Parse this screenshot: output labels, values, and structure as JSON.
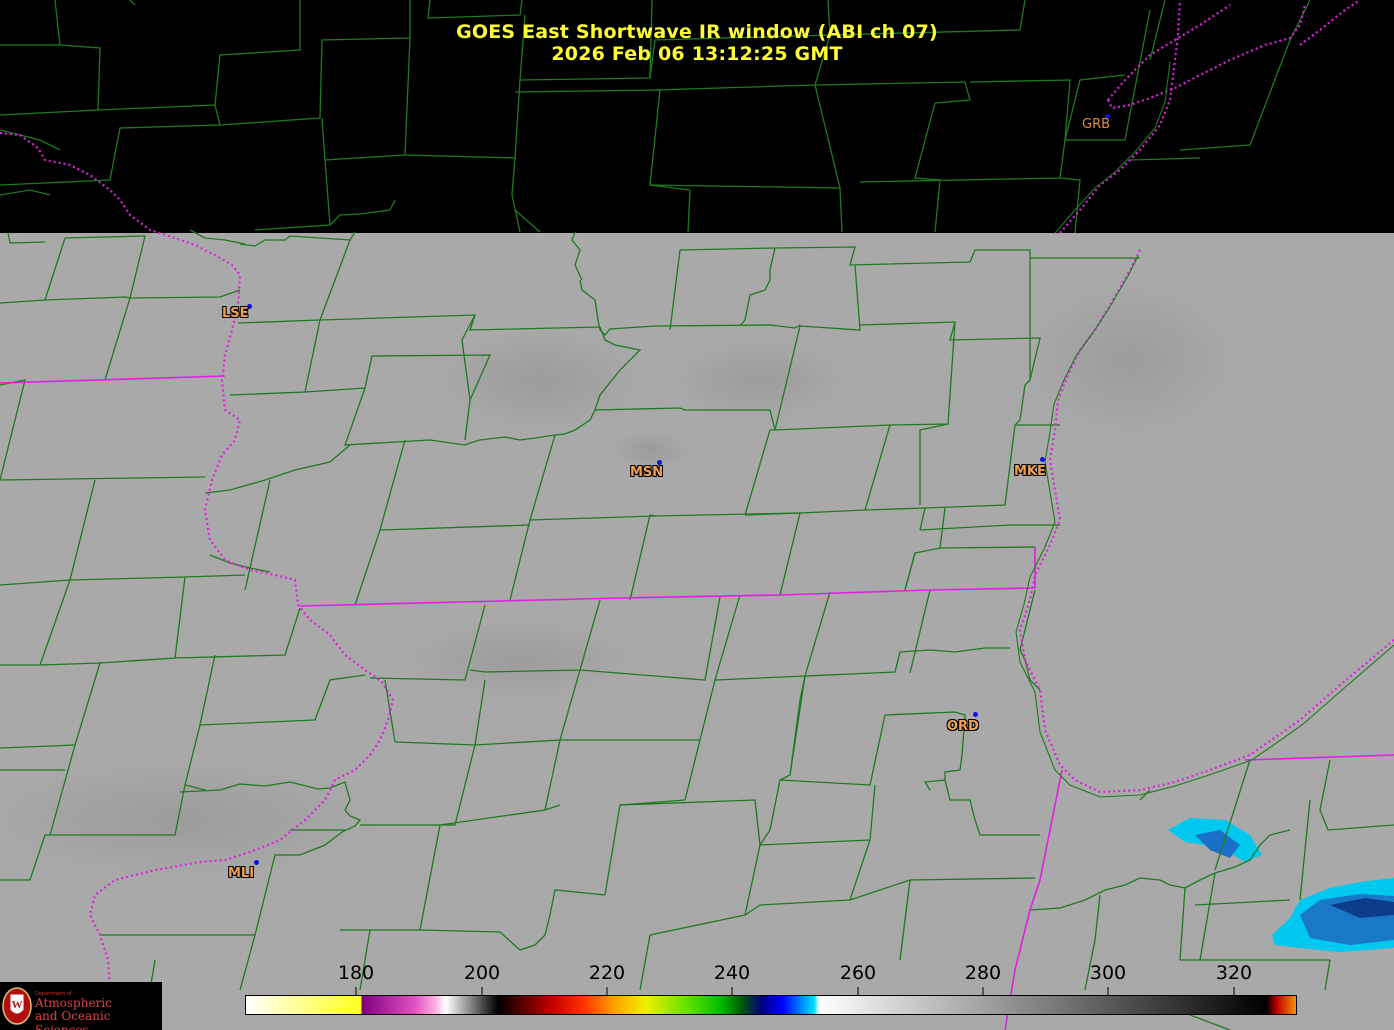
{
  "title": {
    "line1": "GOES East Shortwave IR window (ABI ch 07)",
    "line2": "2026 Feb 06  13:12:25 GMT"
  },
  "stations": [
    {
      "id": "GRB",
      "label": "GRB"
    },
    {
      "id": "LSE",
      "label": "LSE"
    },
    {
      "id": "MSN",
      "label": "MSN"
    },
    {
      "id": "MKE",
      "label": "MKE"
    },
    {
      "id": "ORD",
      "label": "ORD"
    },
    {
      "id": "MLI",
      "label": "MLI"
    }
  ],
  "colorbar": {
    "ticks": [
      "180",
      "200",
      "220",
      "240",
      "260",
      "280",
      "300",
      "320"
    ]
  },
  "logo": {
    "dept": "Department of",
    "line1": "Atmospheric",
    "line2": "and Oceanic Sciences",
    "seal_letter": "W"
  },
  "colors": {
    "title": "#ffff33",
    "county_lines": "#1f7a1f",
    "state_lines": "#e020e0",
    "station_label": "#f0a050",
    "station_dot": "#1010e0",
    "cloud_gray": "#a9a9a9"
  }
}
